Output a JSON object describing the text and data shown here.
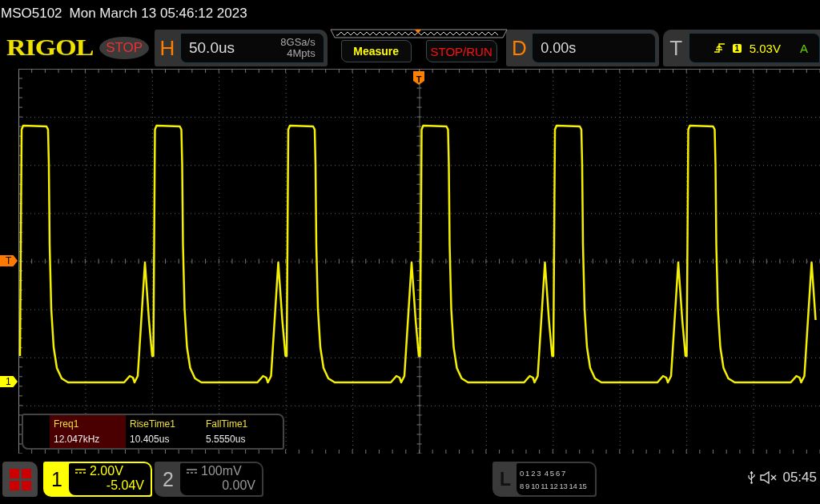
{
  "title_bar": {
    "model": "MSO5102",
    "datetime": "Mon March 13 05:46:12 2023"
  },
  "header": {
    "logo": "RIGOL",
    "run_state": "STOP",
    "horizontal": {
      "label": "H",
      "timebase": "50.0us",
      "sample_rate": "8GSa/s",
      "memory_depth": "4Mpts"
    },
    "buttons": [
      {
        "label": "Measure",
        "kind": "measure"
      },
      {
        "label": "STOP/RUN",
        "kind": "run"
      }
    ],
    "delay": {
      "label": "D",
      "value": "0.00s"
    },
    "trigger": {
      "label": "T",
      "source": "1",
      "level": "5.03V",
      "mode": "A"
    }
  },
  "markers": [
    {
      "label": "T",
      "kind": "trigger_position"
    },
    {
      "label": "T",
      "kind": "trigger_level"
    },
    {
      "label": "1",
      "kind": "channel"
    }
  ],
  "measurements": [
    {
      "name": "Freq1",
      "value": "12.047kHz",
      "selected": true
    },
    {
      "name": "RiseTime1",
      "value": "10.405us",
      "selected": false
    },
    {
      "name": "FallTime1",
      "value": "5.5550us",
      "selected": false
    }
  ],
  "channels": [
    {
      "number": "1",
      "scale": "2.00V",
      "offset": "-5.04V",
      "selected": true
    },
    {
      "number": "2",
      "scale": "100mV",
      "offset": "0.00V",
      "selected": false
    }
  ],
  "logic": {
    "label": "L",
    "rows": [
      "0 1 2 3  4 5 6 7",
      "8 9 10 11 12 13 14 15"
    ]
  },
  "status": {
    "time": "05:45"
  }
}
